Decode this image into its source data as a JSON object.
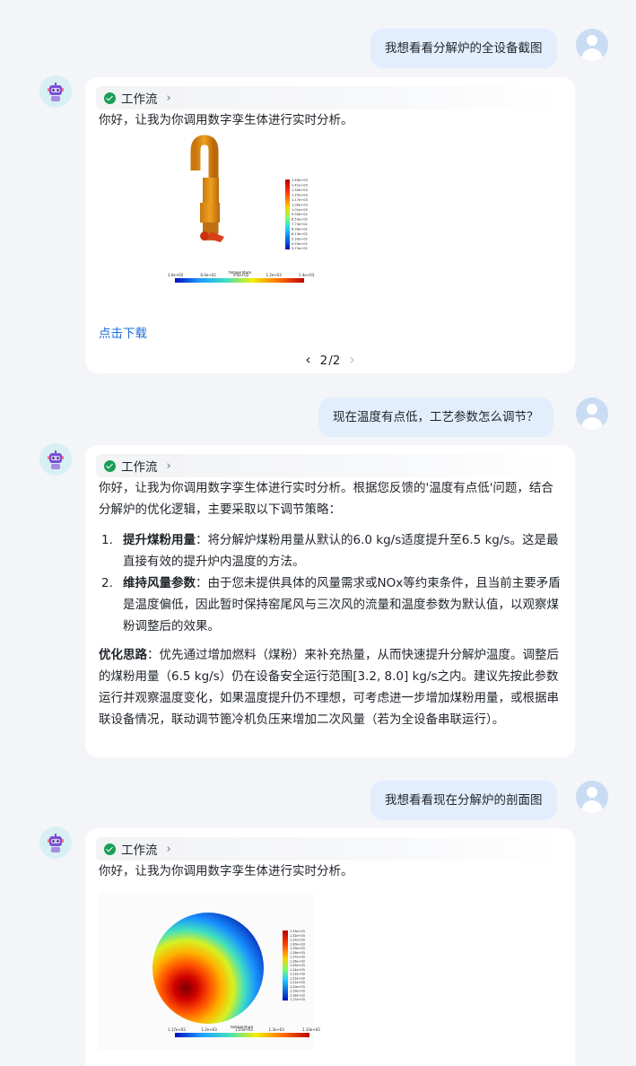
{
  "messages": {
    "u1": "我想看看分解炉的全设备截图",
    "u2": "现在温度有点低，工艺参数怎么调节？",
    "u3": "我想看看现在分解炉的剖面图"
  },
  "workflow_label": "工作流",
  "bot1": {
    "intro": "你好，让我为你调用数字孪生体进行实时分析。",
    "download": "点击下载",
    "pager": {
      "prev": "‹",
      "current": "2",
      "sep": "/2",
      "next": "›"
    },
    "legend_ticks": [
      "1.49e+03",
      "1.41e+03",
      "1.33e+03",
      "1.25e+03",
      "1.17e+03",
      "1.09e+03",
      "1.01e+03",
      "9.33e+02",
      "8.53e+02",
      "7.73e+02",
      "6.93e+02",
      "6.13e+02",
      "5.33e+02",
      "4.53e+02",
      "3.73e+02"
    ],
    "bar_ticks": [
      "3.0e+02",
      "6.0e+02",
      "9.0e+02",
      "1.2e+03",
      "1.4e+03"
    ],
    "bar_title": "temperature"
  },
  "bot2": {
    "intro": "你好，让我为你调用数字孪生体进行实时分析。根据您反馈的'温度有点低'问题，结合分解炉的优化逻辑，主要采取以下调节策略：",
    "items": [
      {
        "num": "1.",
        "bold": "提升煤粉用量",
        "text": "：将分解炉煤粉用量从默认的6.0 kg/s适度提升至6.5 kg/s。这是最直接有效的提升炉内温度的方法。"
      },
      {
        "num": "2.",
        "bold": "维持风量参数",
        "text": "：由于您未提供具体的风量需求或NOx等约束条件，且当前主要矛盾是温度偏低，因此暂时保持窑尾风与三次风的流量和温度参数为默认值，以观察煤粉调整后的效果。"
      }
    ],
    "summary_bold": "优化思路",
    "summary": "：优先通过增加燃料（煤粉）来补充热量，从而快速提升分解炉温度。调整后的煤粉用量（6.5 kg/s）仍在设备安全运行范围[3.2, 8.0] kg/s之内。建议先按此参数运行并观察温度变化，如果温度提升仍不理想，可考虑进一步增加煤粉用量，或根据串联设备情况，联动调节篦冷机负压来增加二次风量（若为全设备串联运行）。"
  },
  "bot3": {
    "intro": "你好，让我为你调用数字孪生体进行实时分析。",
    "legend_ticks": [
      "1.33e+03",
      "1.32e+03",
      "1.31e+03",
      "1.30e+03",
      "1.29e+03",
      "1.28e+03",
      "1.27e+03",
      "1.26e+03",
      "1.25e+03",
      "1.24e+03",
      "1.23e+03",
      "1.22e+03",
      "1.21e+03",
      "1.20e+03",
      "1.19e+03",
      "1.18e+03",
      "1.17e+03"
    ],
    "bar_ticks": [
      "1.17e+03",
      "1.2e+03",
      "1.25e+03",
      "1.3e+03",
      "1.33e+03"
    ],
    "bar_title": "temperature"
  },
  "colors": {
    "accent": "#1e6fd9",
    "check": "#1a9e57",
    "user_bubble": "#e3eefc"
  }
}
